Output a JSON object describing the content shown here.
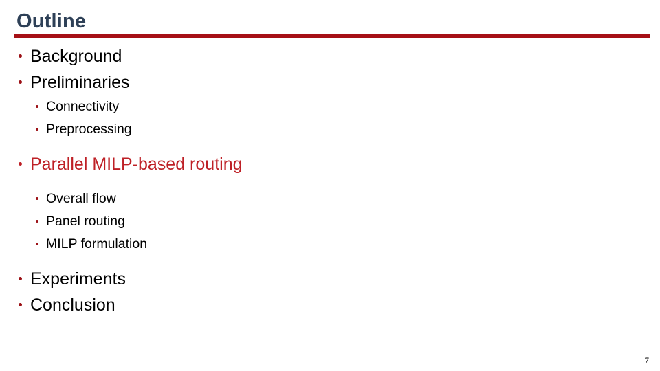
{
  "slide": {
    "title": "Outline",
    "page_number": "7",
    "colors": {
      "title_text": "#2e4057",
      "rule": "#a61016",
      "bullet_dot": "#9c1116",
      "accent_text": "#be2026",
      "body_text": "#000000",
      "background": "#ffffff"
    }
  },
  "outline": {
    "items": [
      {
        "label": "Background",
        "level": 1,
        "accent": false,
        "gap_before": false
      },
      {
        "label": "Preliminaries",
        "level": 1,
        "accent": false,
        "gap_before": false
      },
      {
        "label": "Connectivity",
        "level": 2,
        "accent": false,
        "gap_before": false
      },
      {
        "label": "Preprocessing",
        "level": 2,
        "accent": false,
        "gap_before": false
      },
      {
        "label": "Parallel MILP-based routing",
        "level": 1,
        "accent": true,
        "gap_before": true
      },
      {
        "label": "Overall flow",
        "level": 2,
        "accent": false,
        "gap_before": true
      },
      {
        "label": "Panel routing",
        "level": 2,
        "accent": false,
        "gap_before": false
      },
      {
        "label": "MILP formulation",
        "level": 2,
        "accent": false,
        "gap_before": false
      },
      {
        "label": "Experiments",
        "level": 1,
        "accent": false,
        "gap_before": true
      },
      {
        "label": "Conclusion",
        "level": 1,
        "accent": false,
        "gap_before": false
      }
    ]
  }
}
